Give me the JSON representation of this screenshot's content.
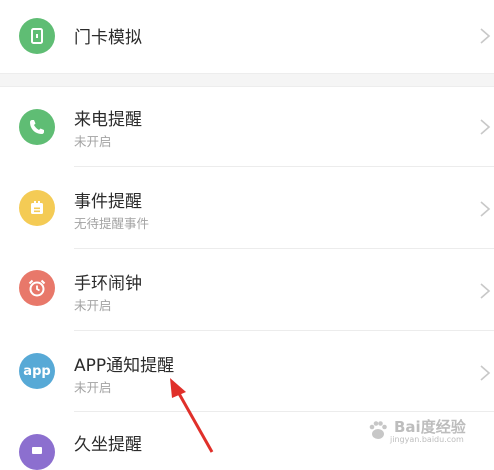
{
  "items": [
    {
      "title": "门卡模拟",
      "subtitle": "",
      "icon": "door-card-icon",
      "color": "#5fbd74"
    },
    {
      "title": "来电提醒",
      "subtitle": "未开启",
      "icon": "phone-icon",
      "color": "#5fbd74"
    },
    {
      "title": "事件提醒",
      "subtitle": "无待提醒事件",
      "icon": "calendar-icon",
      "color": "#f4cb55"
    },
    {
      "title": "手环闹钟",
      "subtitle": "未开启",
      "icon": "alarm-clock-icon",
      "color": "#e8786a"
    },
    {
      "title": "APP通知提醒",
      "subtitle": "未开启",
      "icon": "app-icon",
      "icon_text": "app",
      "color": "#57a9d6"
    },
    {
      "title": "久坐提醒",
      "subtitle": "",
      "icon": "sedentary-icon",
      "color": "#8c6fcf"
    }
  ],
  "watermark": {
    "brand": "Bai度经验",
    "url": "jingyan.baidu.com"
  },
  "annotation_arrow_color": "#e0302a"
}
